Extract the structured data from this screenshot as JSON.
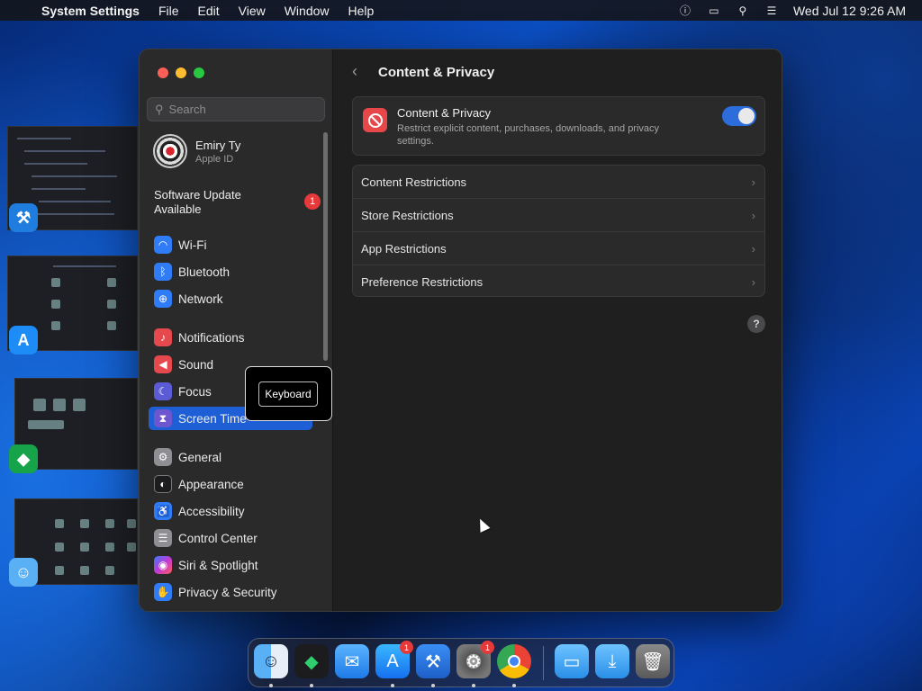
{
  "menubar": {
    "app": "System Settings",
    "menus": [
      "File",
      "Edit",
      "View",
      "Window",
      "Help"
    ],
    "clock": "Wed Jul 12  9:26 AM"
  },
  "sidebar": {
    "search_placeholder": "Search",
    "account": {
      "name": "Emiry Ty",
      "subtitle": "Apple ID"
    },
    "software_update": {
      "label": "Software Update Available",
      "badge": "1"
    },
    "items": [
      {
        "label": "Wi-Fi",
        "icon": "wifi-icon",
        "color": "#2f7cf6"
      },
      {
        "label": "Bluetooth",
        "icon": "bluetooth-icon",
        "color": "#2f7cf6"
      },
      {
        "label": "Network",
        "icon": "globe-icon",
        "color": "#2f7cf6"
      },
      {
        "label": "Notifications",
        "icon": "bell-icon",
        "color": "#e5484d"
      },
      {
        "label": "Sound",
        "icon": "speaker-icon",
        "color": "#e5484d"
      },
      {
        "label": "Focus",
        "icon": "moon-icon",
        "color": "#5b5bd6"
      },
      {
        "label": "Screen Time",
        "icon": "hourglass-icon",
        "color": "#6e56cf"
      },
      {
        "label": "General",
        "icon": "gear-icon",
        "color": "#8e8e93"
      },
      {
        "label": "Appearance",
        "icon": "appearance-icon",
        "color": "#1c1c1e"
      },
      {
        "label": "Accessibility",
        "icon": "accessibility-icon",
        "color": "#2f7cf6"
      },
      {
        "label": "Control Center",
        "icon": "toggles-icon",
        "color": "#8e8e93"
      },
      {
        "label": "Siri & Spotlight",
        "icon": "siri-icon",
        "color": "#b23fd1"
      },
      {
        "label": "Privacy & Security",
        "icon": "hand-icon",
        "color": "#2f7cf6"
      }
    ],
    "tooltip": "Keyboard"
  },
  "content": {
    "title": "Content & Privacy",
    "card": {
      "title": "Content & Privacy",
      "description": "Restrict explicit content, purchases, downloads, and privacy settings.",
      "enabled": true
    },
    "rows": [
      "Content Restrictions",
      "Store Restrictions",
      "App Restrictions",
      "Preference Restrictions"
    ],
    "help": "?"
  },
  "dock": {
    "badges": {
      "app_store": "1",
      "system_settings": "1"
    }
  }
}
